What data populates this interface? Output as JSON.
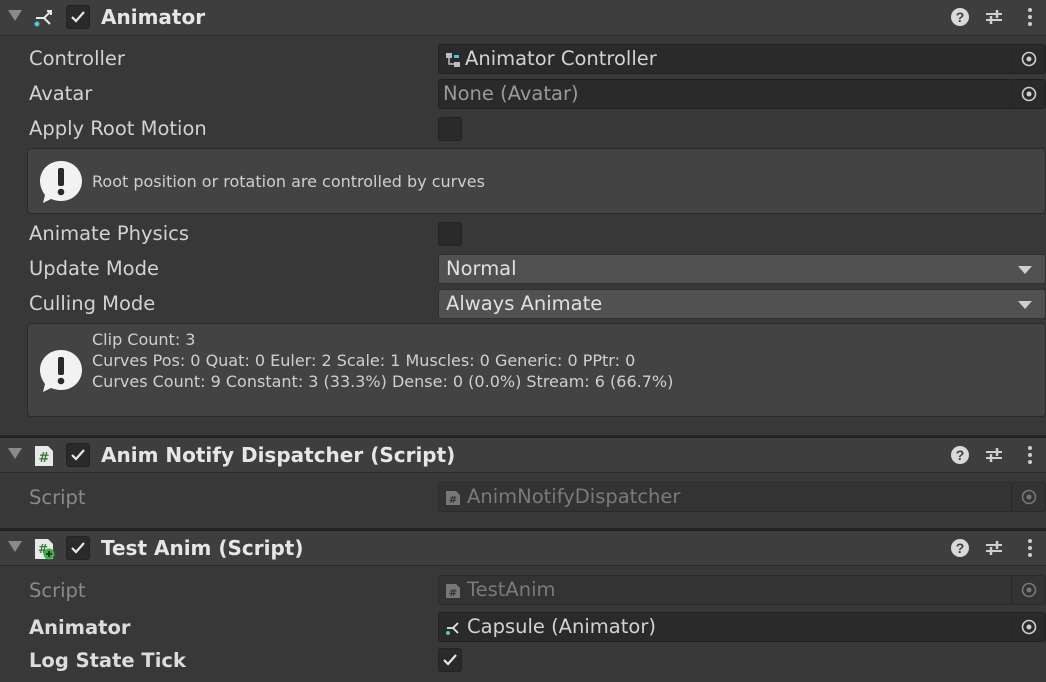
{
  "animator": {
    "title": "Animator",
    "enabled": true,
    "controller": {
      "label": "Controller",
      "value": "Animator Controller"
    },
    "avatar": {
      "label": "Avatar",
      "value": "None (Avatar)"
    },
    "apply_root_motion": {
      "label": "Apply Root Motion",
      "checked": false
    },
    "root_info": "Root position or rotation are controlled by curves",
    "animate_physics": {
      "label": "Animate Physics",
      "checked": false
    },
    "update_mode": {
      "label": "Update Mode",
      "value": "Normal"
    },
    "culling_mode": {
      "label": "Culling Mode",
      "value": "Always Animate"
    },
    "clip_info": {
      "line1": "Clip Count: 3",
      "line2": "Curves Pos: 0 Quat: 0 Euler: 2 Scale: 1 Muscles: 0 Generic: 0 PPtr: 0",
      "line3": "Curves Count: 9 Constant: 3 (33.3%) Dense: 0 (0.0%) Stream: 6 (66.7%)"
    }
  },
  "anim_notify": {
    "title": "Anim Notify Dispatcher (Script)",
    "enabled": true,
    "script": {
      "label": "Script",
      "value": "AnimNotifyDispatcher"
    }
  },
  "test_anim": {
    "title": "Test Anim (Script)",
    "enabled": true,
    "script": {
      "label": "Script",
      "value": "TestAnim"
    },
    "animator_field": {
      "label": "Animator",
      "value": "Capsule (Animator)"
    },
    "log_state_tick": {
      "label": "Log State Tick",
      "checked": true
    }
  },
  "icons": {
    "help": "help-icon",
    "presets": "presets-icon",
    "menu": "kebab-menu-icon",
    "animator": "animator-icon",
    "script": "csharp-script-icon",
    "picker": "object-picker-icon",
    "warning": "info-exclamation-icon"
  }
}
